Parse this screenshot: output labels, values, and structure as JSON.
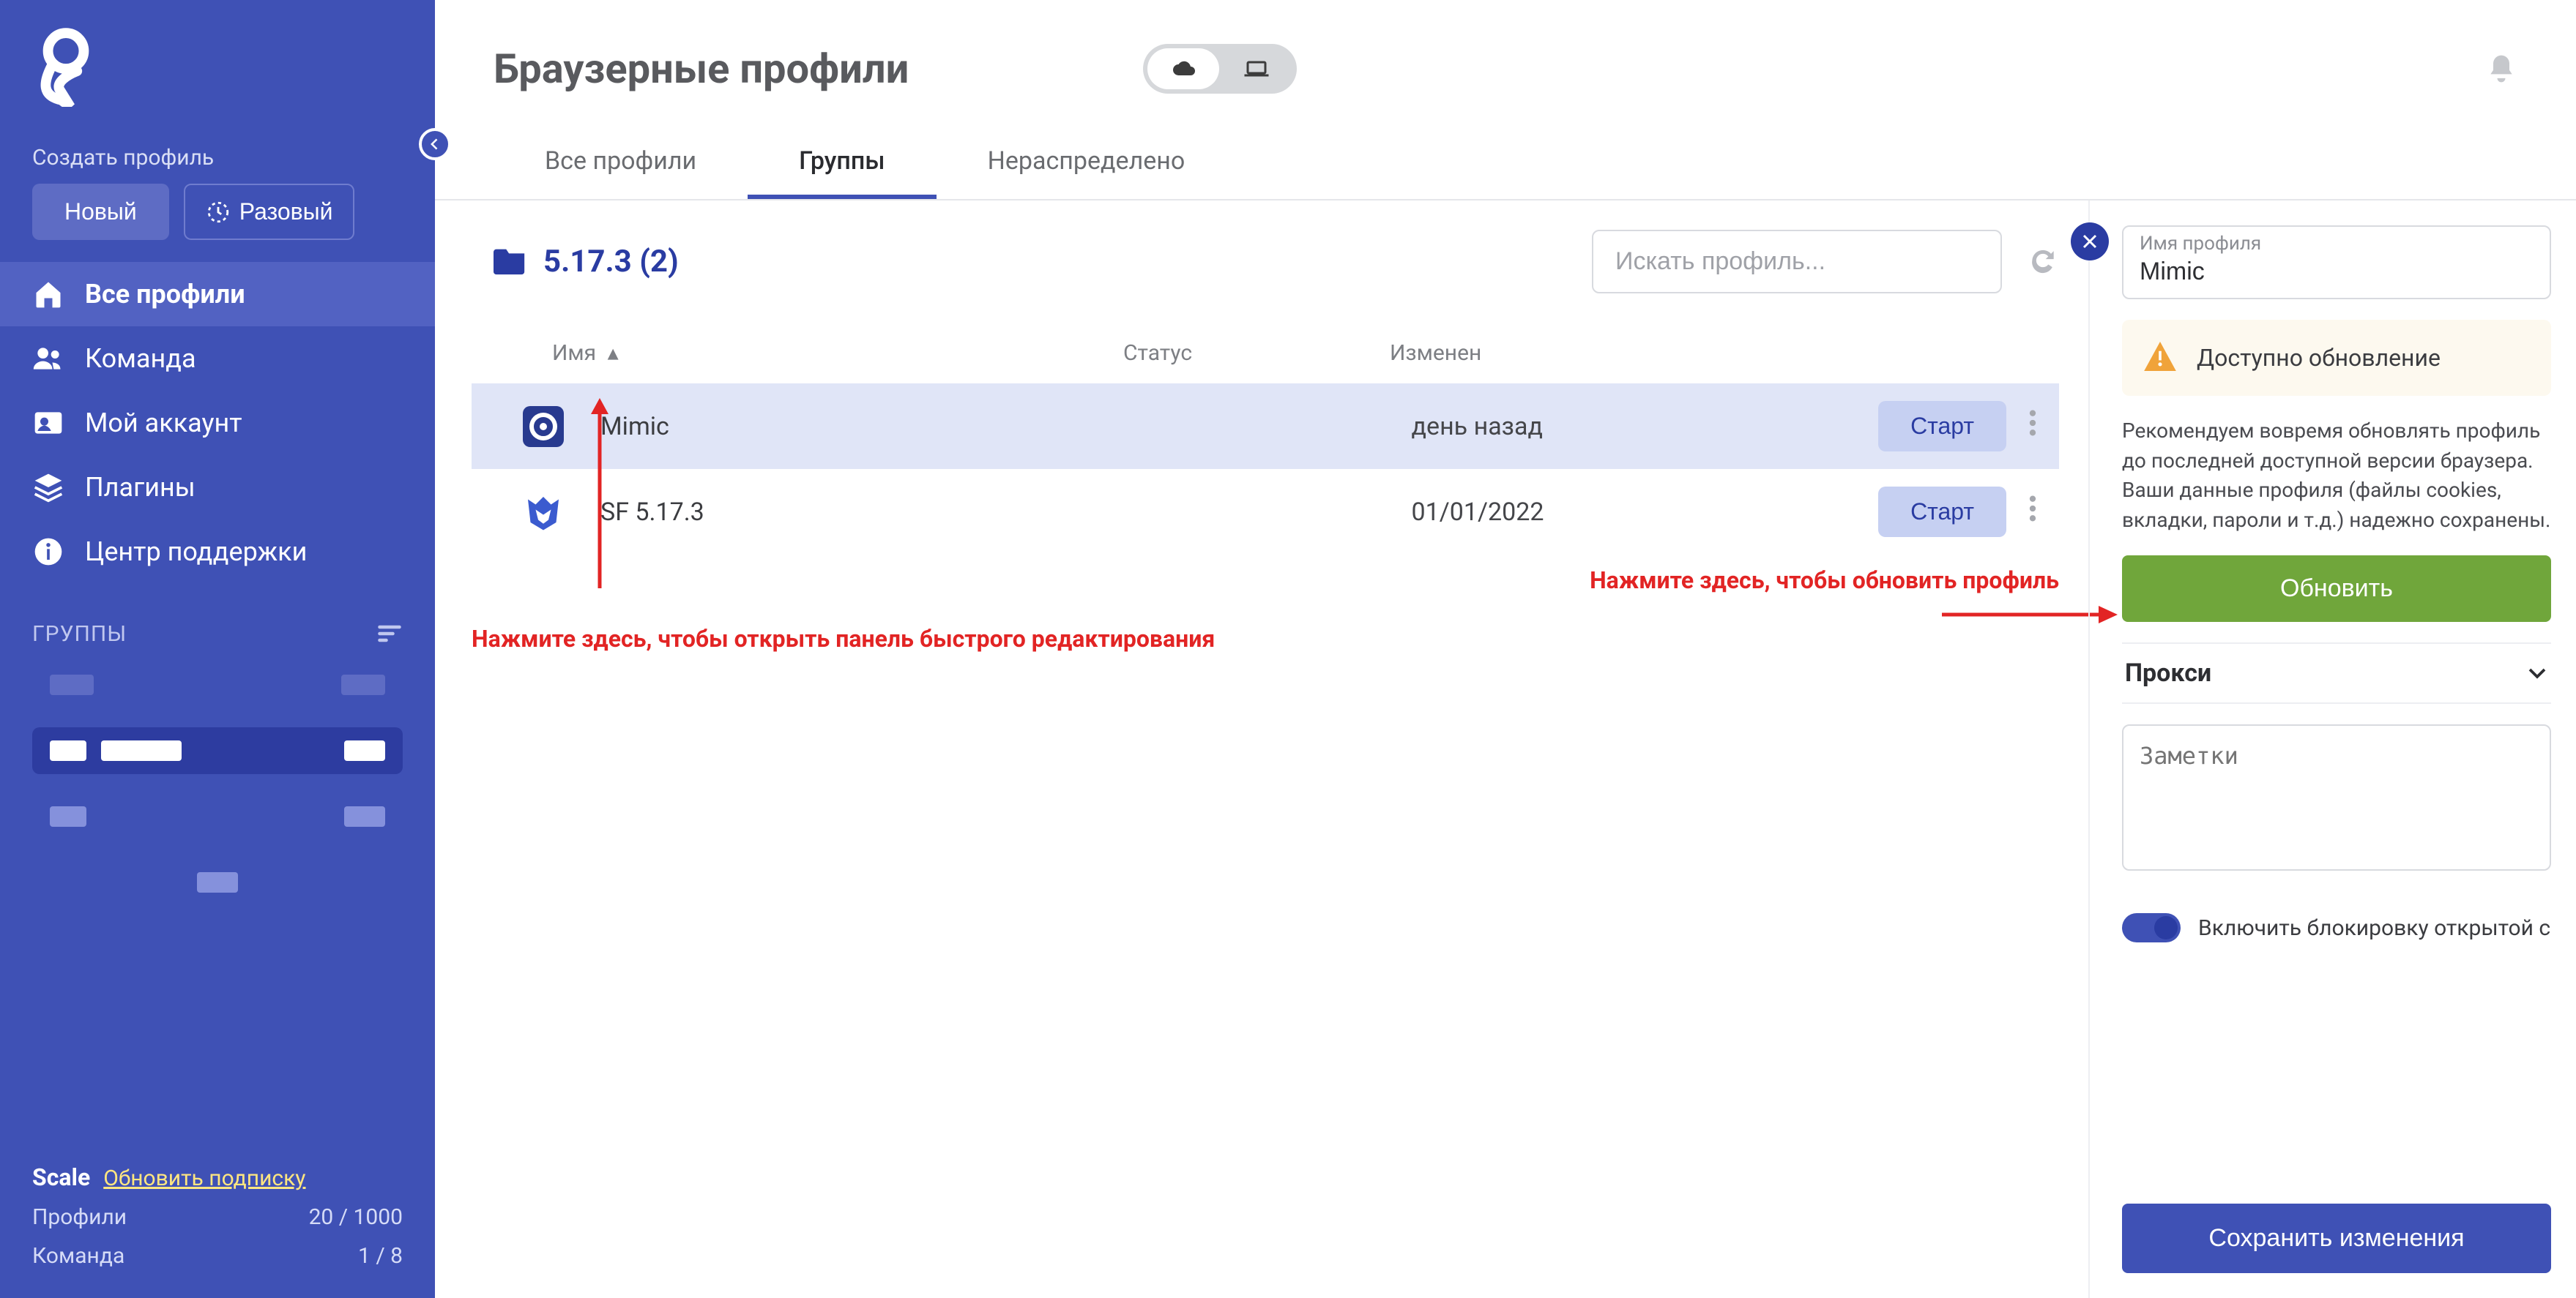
{
  "sidebar": {
    "create_label": "Создать профиль",
    "new_label": "Новый",
    "quick_label": "Разовый",
    "nav": [
      {
        "label": "Все профили"
      },
      {
        "label": "Команда"
      },
      {
        "label": "Мой аккаунт"
      },
      {
        "label": "Плагины"
      },
      {
        "label": "Центр поддержки"
      }
    ],
    "groups_header": "ГРУППЫ",
    "footer": {
      "plan": "Scale",
      "update_link": "Обновить подписку",
      "profiles_label": "Профили",
      "profiles_value": "20 / 1000",
      "team_label": "Команда",
      "team_value": "1 / 8"
    }
  },
  "header": {
    "title": "Браузерные профили"
  },
  "tabs": [
    {
      "label": "Все профили"
    },
    {
      "label": "Группы"
    },
    {
      "label": "Нераспределено"
    }
  ],
  "group": {
    "name": "5.17.3 (2)",
    "search_placeholder": "Искать профиль..."
  },
  "columns": {
    "name": "Имя",
    "status": "Статус",
    "modified": "Изменен"
  },
  "rows": [
    {
      "name": "Mimic",
      "modified": "день назад",
      "start": "Старт"
    },
    {
      "name": "SF 5.17.3",
      "modified": "01/01/2022",
      "start": "Старт"
    }
  ],
  "annotations": {
    "edit_hint": "Нажмите здесь, чтобы открыть панель быстрого редактирования",
    "update_hint": "Нажмите здесь, чтобы обновить профиль"
  },
  "panel": {
    "name_label": "Имя профиля",
    "name_value": "Mimic",
    "alert": "Доступно обновление",
    "help": "Рекомендуем вовремя обновлять профиль до последней доступной версии браузера. Ваши данные профиля (файлы cookies, вкладки, пароли и т.д.) надежно сохранены.",
    "update_btn": "Обновить",
    "proxy": "Прокси",
    "notes_placeholder": "Заметки",
    "toggle_label": "Включить блокировку открытой с...",
    "save_btn": "Сохранить изменения"
  }
}
